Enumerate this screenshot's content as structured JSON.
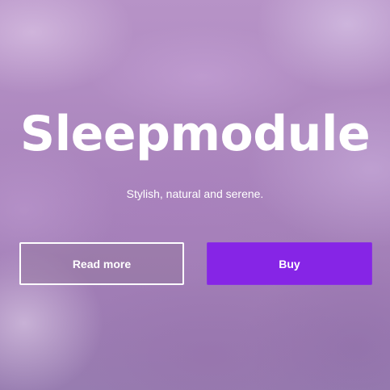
{
  "hero": {
    "title": "Sleepmodule",
    "subtitle": "Stylish, natural and serene."
  },
  "actions": {
    "read_more_label": "Read more",
    "buy_label": "Buy"
  },
  "colors": {
    "background": "#a985bb",
    "primary_button": "#8625e6",
    "text": "#ffffff"
  }
}
